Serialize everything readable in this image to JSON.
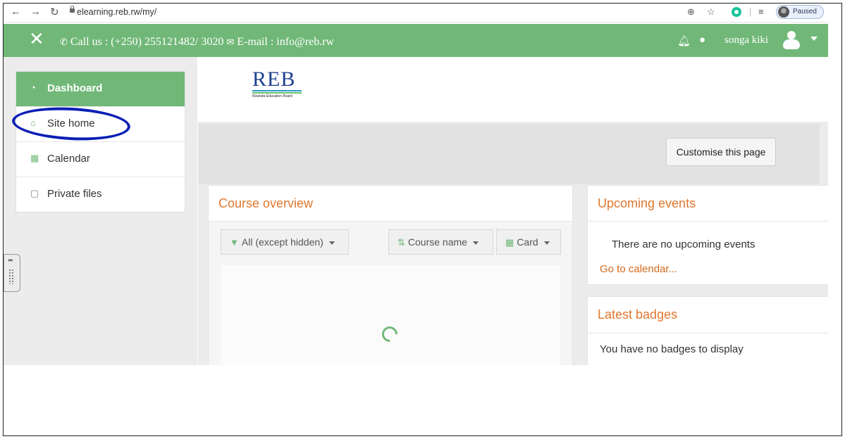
{
  "browser": {
    "url": "elearning.reb.rw/my/",
    "paused_label": "Paused",
    "icons": [
      "back-icon",
      "forward-icon",
      "reload-icon",
      "lock-icon",
      "zoom-icon",
      "star-icon",
      "grammarly-icon",
      "reading-list-icon"
    ]
  },
  "topbar": {
    "contact": "Call us : (+250) 255121482/ 3020",
    "email": "E-mail : info@reb.rw",
    "username": "songa kiki",
    "color": "#71b878"
  },
  "nav": {
    "items": [
      {
        "label": "Dashboard",
        "icon": "dashboard-icon",
        "active": true
      },
      {
        "label": "Site home",
        "icon": "home-icon",
        "active": false
      },
      {
        "label": "Calendar",
        "icon": "calendar-icon",
        "active": false
      },
      {
        "label": "Private files",
        "icon": "file-icon",
        "active": false
      }
    ]
  },
  "logo": {
    "text": "REB",
    "subtitle": "Rwanda Education Board"
  },
  "page": {
    "customise_button": "Customise this page"
  },
  "course_overview": {
    "title": "Course overview",
    "filter": "All (except hidden)",
    "sort": "Course name",
    "view": "Card"
  },
  "upcoming_events": {
    "title": "Upcoming events",
    "empty": "There are no upcoming events",
    "link": "Go to calendar..."
  },
  "latest_badges": {
    "title": "Latest badges",
    "empty": "You have no badges to display"
  },
  "colors": {
    "accent_green": "#71b878",
    "title_orange": "#e0772e",
    "annotation_blue": "#0a1fb5"
  }
}
